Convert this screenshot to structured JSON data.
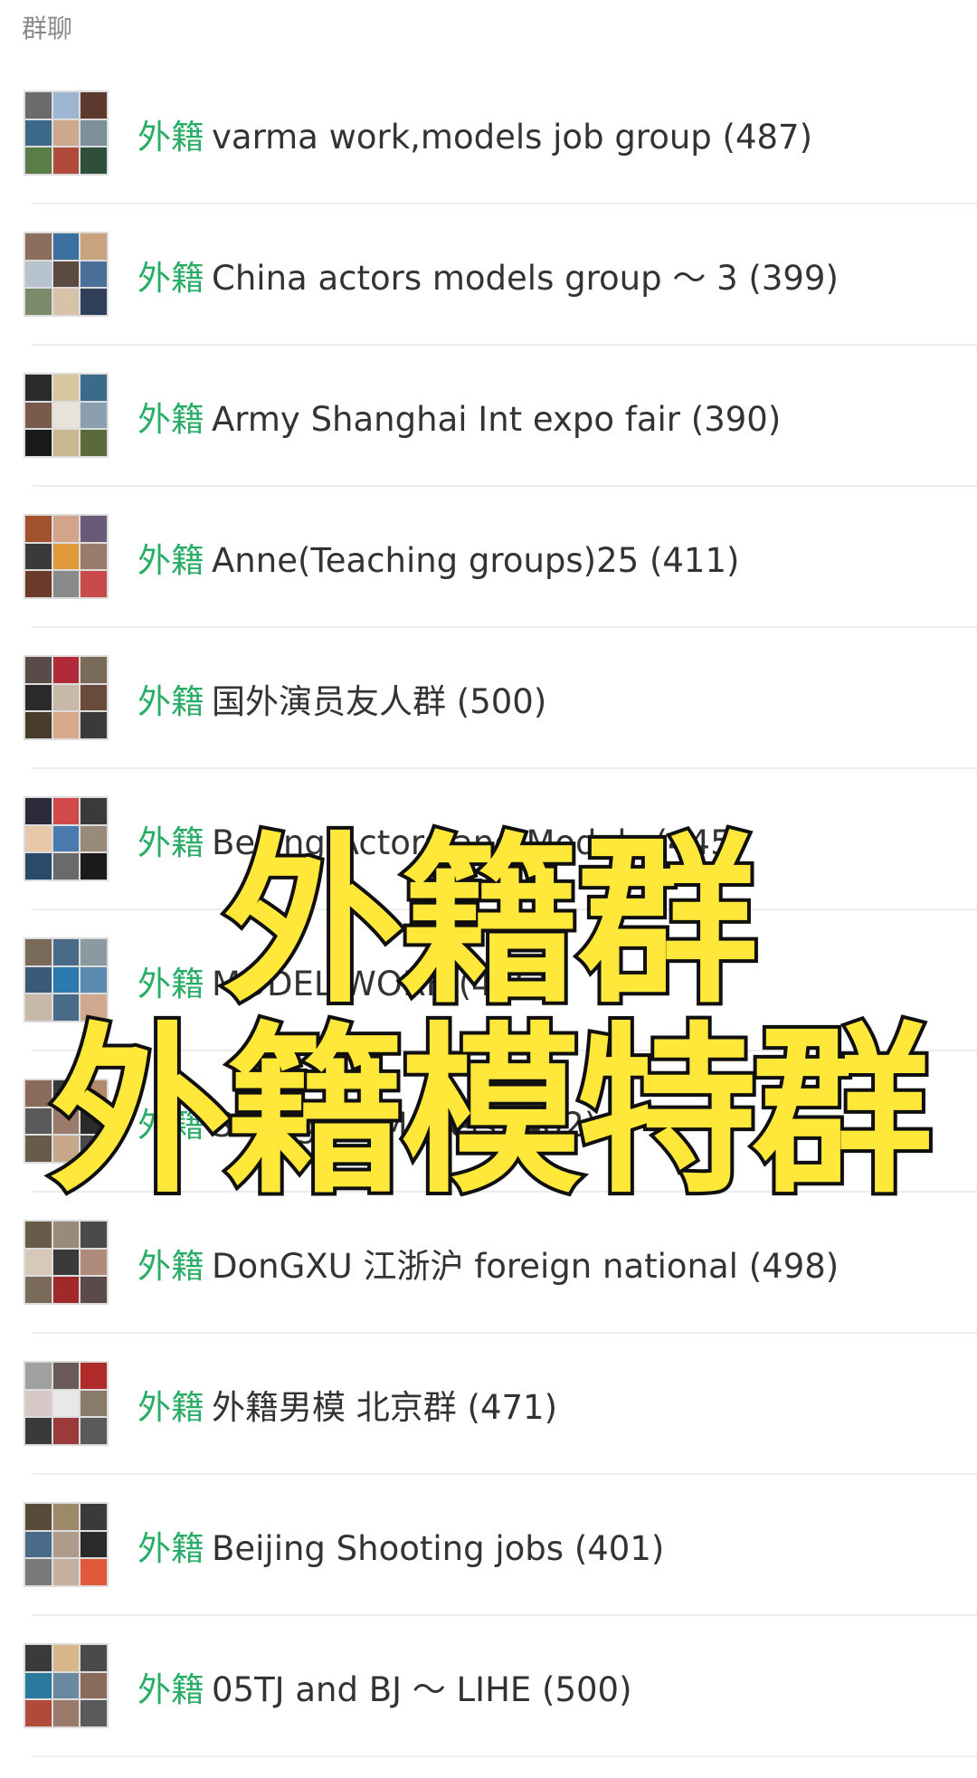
{
  "section_header": "群聊",
  "tag_label": "外籍",
  "groups": [
    {
      "name": "varma work,models job group (487)",
      "colors": [
        "#6b6b6b",
        "#9db7d2",
        "#5c3a2e",
        "#3e6a8a",
        "#cda88a",
        "#7d8f9a",
        "#5a7d47",
        "#b04a3a",
        "#2f4f3a"
      ]
    },
    {
      "name": "China actors models group ～ 3 (399)",
      "colors": [
        "#8a6d5a",
        "#3a6fa0",
        "#c9a27e",
        "#b7c4cf",
        "#5a4a40",
        "#4a6f9a",
        "#7a8a6a",
        "#d8c2a8",
        "#2f3f5a"
      ]
    },
    {
      "name": "Army Shanghai Int expo fair (390)",
      "colors": [
        "#2a2a2a",
        "#d8c8a0",
        "#3c6a8a",
        "#7a5a4a",
        "#e8e2d8",
        "#8aa0b0",
        "#1a1a1a",
        "#c8b890",
        "#5a6a3a"
      ]
    },
    {
      "name": "Anne(Teaching groups)25 (411)",
      "colors": [
        "#a0522d",
        "#d4a48a",
        "#6a5a7a",
        "#3a3a3a",
        "#e09a3a",
        "#9a7a6a",
        "#6a3a2a",
        "#8a8a8a",
        "#c84a4a"
      ]
    },
    {
      "name": "国外演员友人群 (500)",
      "colors": [
        "#5a4a4a",
        "#b02a3a",
        "#7a6a5a",
        "#2a2a2a",
        "#c8b8a8",
        "#6a4a3a",
        "#4a3a2a",
        "#d8a88a",
        "#3a3a3a"
      ]
    },
    {
      "name": "Beijing Actors and Models (445)",
      "colors": [
        "#2a2a3a",
        "#d04a4a",
        "#3a3a3a",
        "#e8c8a8",
        "#4a7ab0",
        "#9a8a7a",
        "#2a4a6a",
        "#6a6a6a",
        "#1a1a1a"
      ]
    },
    {
      "name": "MODEL WORK (496)",
      "colors": [
        "#7a6a5a",
        "#4a6a8a",
        "#8a9aa0",
        "#3a5a7a",
        "#2a7ab0",
        "#5a8ab0",
        "#c8b8a8",
        "#4a6a8a",
        "#d0a890"
      ]
    },
    {
      "name": "Shanghai Models (402)",
      "colors": [
        "#8a6a5a",
        "#3a3a3a",
        "#b08a6a",
        "#5a5a5a",
        "#9a7a6a",
        "#2a2a2a",
        "#6a5a4a",
        "#c8a88a",
        "#4a4a4a"
      ]
    },
    {
      "name": "DonGXU 江浙沪 foreign national (498)",
      "colors": [
        "#6a5a4a",
        "#9a8a7a",
        "#4a4a4a",
        "#d8c8b8",
        "#3a3a3a",
        "#b08a7a",
        "#7a6a5a",
        "#a02a2a",
        "#5a4a4a"
      ]
    },
    {
      "name": "外籍男模 北京群 (471)",
      "colors": [
        "#a0a0a0",
        "#6a5a5a",
        "#b02a2a",
        "#d8c8c8",
        "#e8e8e8",
        "#8a7a6a",
        "#3a3a3a",
        "#9a3a3a",
        "#5a5a5a"
      ]
    },
    {
      "name": "Beijing Shooting jobs (401)",
      "colors": [
        "#5a4a3a",
        "#9a8a6a",
        "#3a3a3a",
        "#4a6a8a",
        "#b09a8a",
        "#2a2a2a",
        "#7a7a7a",
        "#c8b0a0",
        "#e05a3a"
      ]
    },
    {
      "name": "05TJ and BJ ～ LIHE (500)",
      "colors": [
        "#3a3a3a",
        "#d8b88a",
        "#4a4a4a",
        "#2a7aa0",
        "#6a8aa0",
        "#8a6a5a",
        "#b04a3a",
        "#9a7a6a",
        "#5a5a5a"
      ]
    }
  ],
  "overlay_lines": [
    "外籍群",
    "外籍模特群"
  ]
}
